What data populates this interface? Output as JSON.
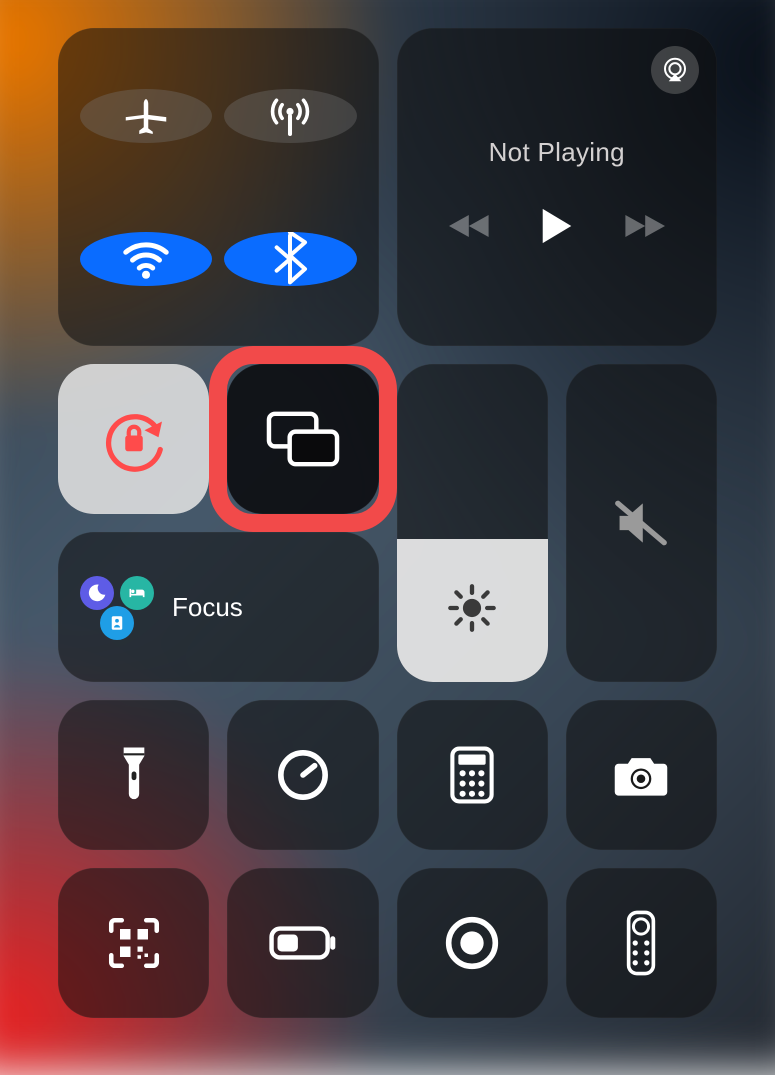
{
  "connectivity": {
    "airplane": {
      "active": false,
      "icon": "airplane-icon"
    },
    "cellular": {
      "active": false,
      "icon": "antenna-icon"
    },
    "wifi": {
      "active": true,
      "icon": "wifi-icon"
    },
    "bluetooth": {
      "active": true,
      "icon": "bluetooth-icon"
    }
  },
  "media": {
    "status_text": "Not Playing",
    "airplay_icon": "airplay-audio-icon",
    "transport": {
      "rewind": "rewind-icon",
      "play": "play-icon",
      "forward": "forward-icon"
    }
  },
  "orientation_lock": {
    "active": true,
    "icon": "rotation-lock-icon"
  },
  "screen_mirroring": {
    "highlighted": true,
    "highlight_color": "#f24a4a",
    "icon": "screen-mirroring-icon"
  },
  "focus": {
    "label": "Focus",
    "modes": [
      "do-not-disturb",
      "sleep",
      "work"
    ]
  },
  "brightness": {
    "level_percent": 45,
    "icon": "sun-icon"
  },
  "volume": {
    "level_percent": 0,
    "muted": true,
    "icon": "speaker-mute-icon"
  },
  "shortcuts_row1": {
    "flashlight": "flashlight-icon",
    "timer": "timer-icon",
    "calculator": "calculator-icon",
    "camera": "camera-icon"
  },
  "shortcuts_row2": {
    "qr_scanner": "qr-code-icon",
    "low_power": "battery-low-power-icon",
    "screen_record": "screen-record-icon",
    "apple_tv_remote": "tv-remote-icon"
  },
  "colors": {
    "tile_bg": "rgba(15,15,15,0.55)",
    "active_blue": "#0a6cff",
    "lock_red": "#ff4b4b"
  }
}
